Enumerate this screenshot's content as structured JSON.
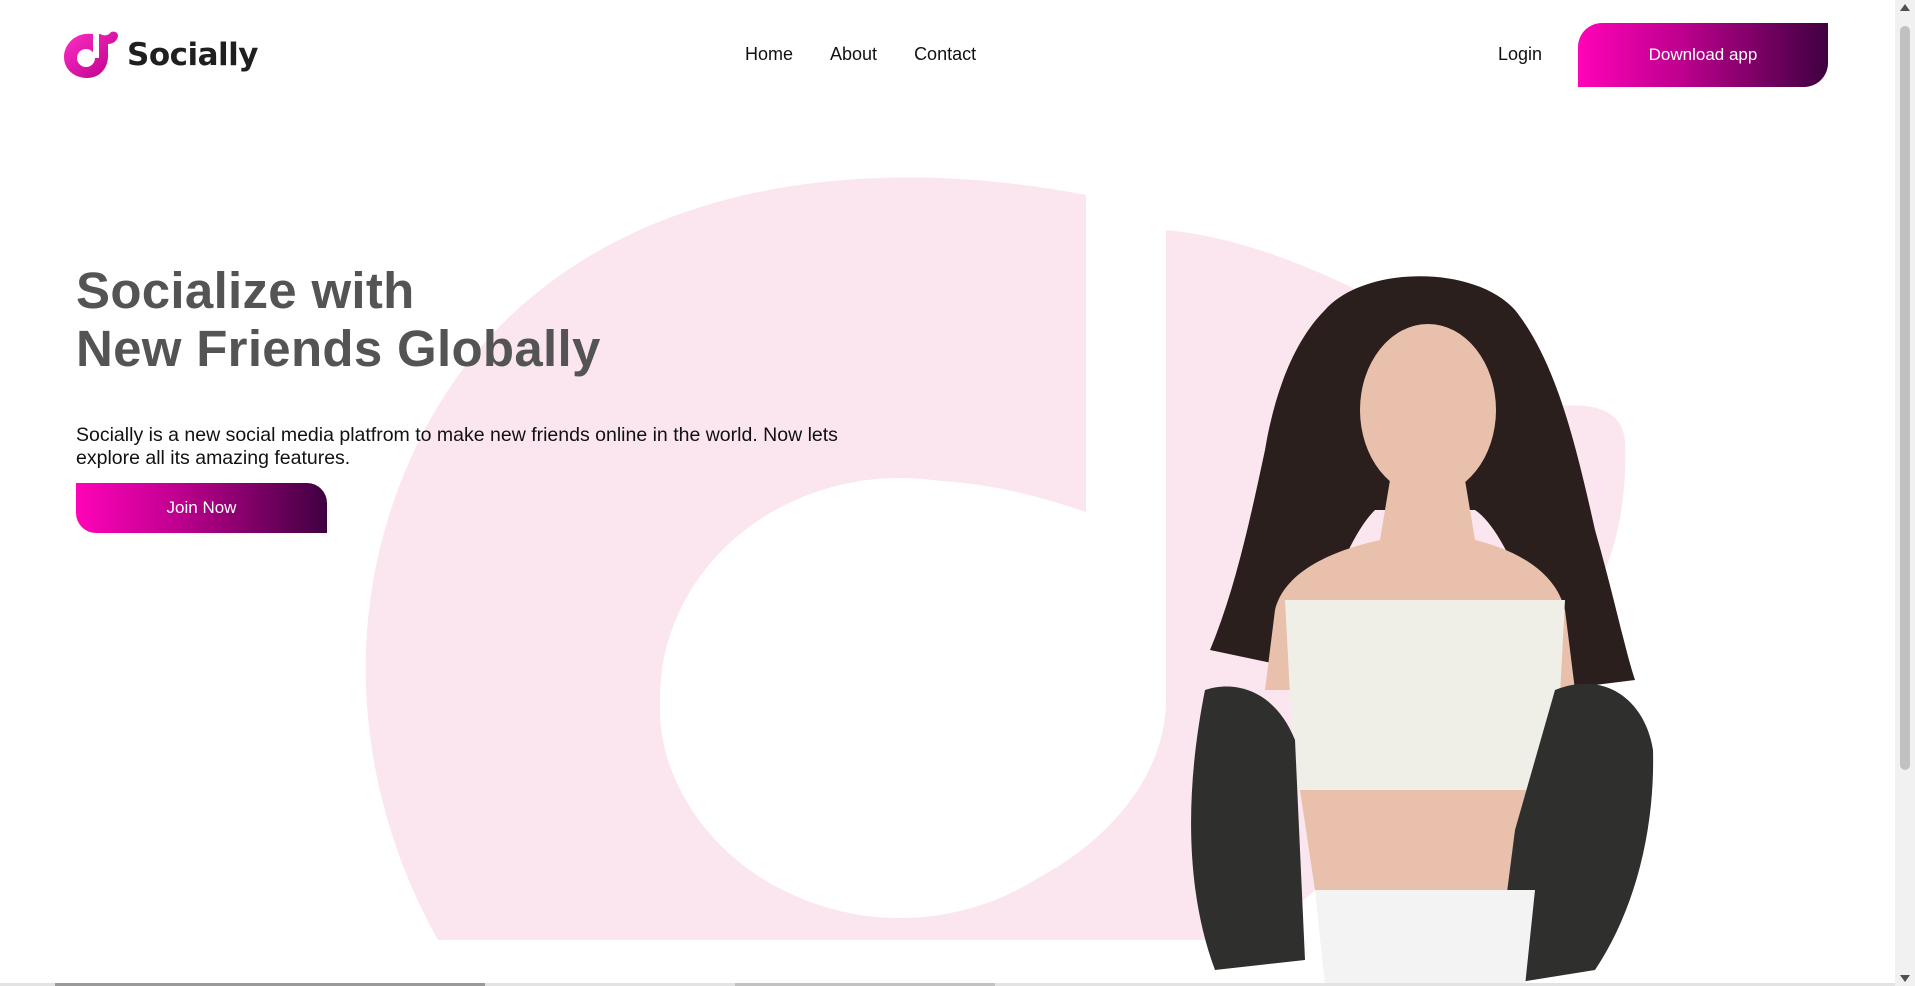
{
  "brand": {
    "name": "Socially",
    "color": "#e0009f"
  },
  "nav": {
    "items": [
      {
        "label": "Home"
      },
      {
        "label": "About"
      },
      {
        "label": "Contact"
      }
    ]
  },
  "header": {
    "login_label": "Login",
    "download_label": "Download app"
  },
  "hero": {
    "title_line1": "Socialize with",
    "title_line2": "New Friends Globally",
    "description": "Socially is a new social media platfrom to make new friends online in the world. Now lets explore all its amazing features.",
    "cta_label": "Join Now"
  },
  "colors": {
    "accent_start": "#ff03b8",
    "accent_end": "#3f0040",
    "bg_mark": "#fbe6ef",
    "heading": "#545454"
  },
  "icons": {
    "logo": "music-note-icon"
  }
}
